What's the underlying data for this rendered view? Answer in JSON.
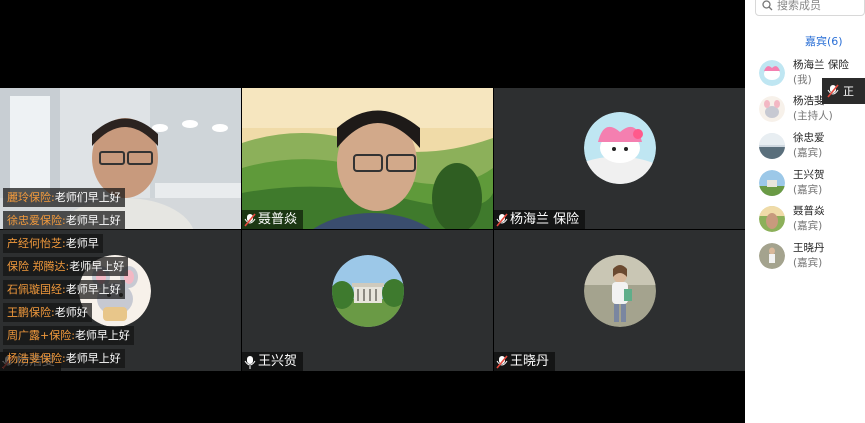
{
  "participants": {
    "p1": {
      "name": ""
    },
    "p2": {
      "name": "聂普焱"
    },
    "p3": {
      "name": "杨海兰 保险"
    },
    "p4": {
      "name": "杨浩斐"
    },
    "p5": {
      "name": "王兴贺"
    },
    "p6": {
      "name": "王晓丹"
    }
  },
  "chat": [
    {
      "name": "麗玲保险:",
      "text": "老师们早上好"
    },
    {
      "name": "徐忠爱保险:",
      "text": "老师早上好"
    },
    {
      "name": "产经何怡芝:",
      "text": "老师早"
    },
    {
      "name": "保险 郑腾达:",
      "text": "老师早上好"
    },
    {
      "name": "石佩璇国经:",
      "text": "老师早上好"
    },
    {
      "name": "王鹏保险:",
      "text": "老师好"
    },
    {
      "name": "周广露+保险:",
      "text": "老师早上好"
    },
    {
      "name": "杨浩斐保险:",
      "text": "老师早上好"
    }
  ],
  "sidebar": {
    "search_placeholder": "搜索成员",
    "tab_label": "嘉宾(6)",
    "members": [
      {
        "name": "杨海兰 保险",
        "role": "(我)"
      },
      {
        "name": "杨浩斐",
        "role": "(主持人)"
      },
      {
        "name": "徐忠爱",
        "role": "(嘉宾)"
      },
      {
        "name": "王兴贺",
        "role": "(嘉宾)"
      },
      {
        "name": "聂普焱",
        "role": "(嘉宾)"
      },
      {
        "name": "王晓丹",
        "role": "(嘉宾)"
      }
    ],
    "popup_text": "正"
  },
  "colors": {
    "accent_blue": "#2a6fd6",
    "chat_name": "#f29a3c",
    "active_border": "#3cc36a",
    "tile_bg": "#2d2f30"
  }
}
